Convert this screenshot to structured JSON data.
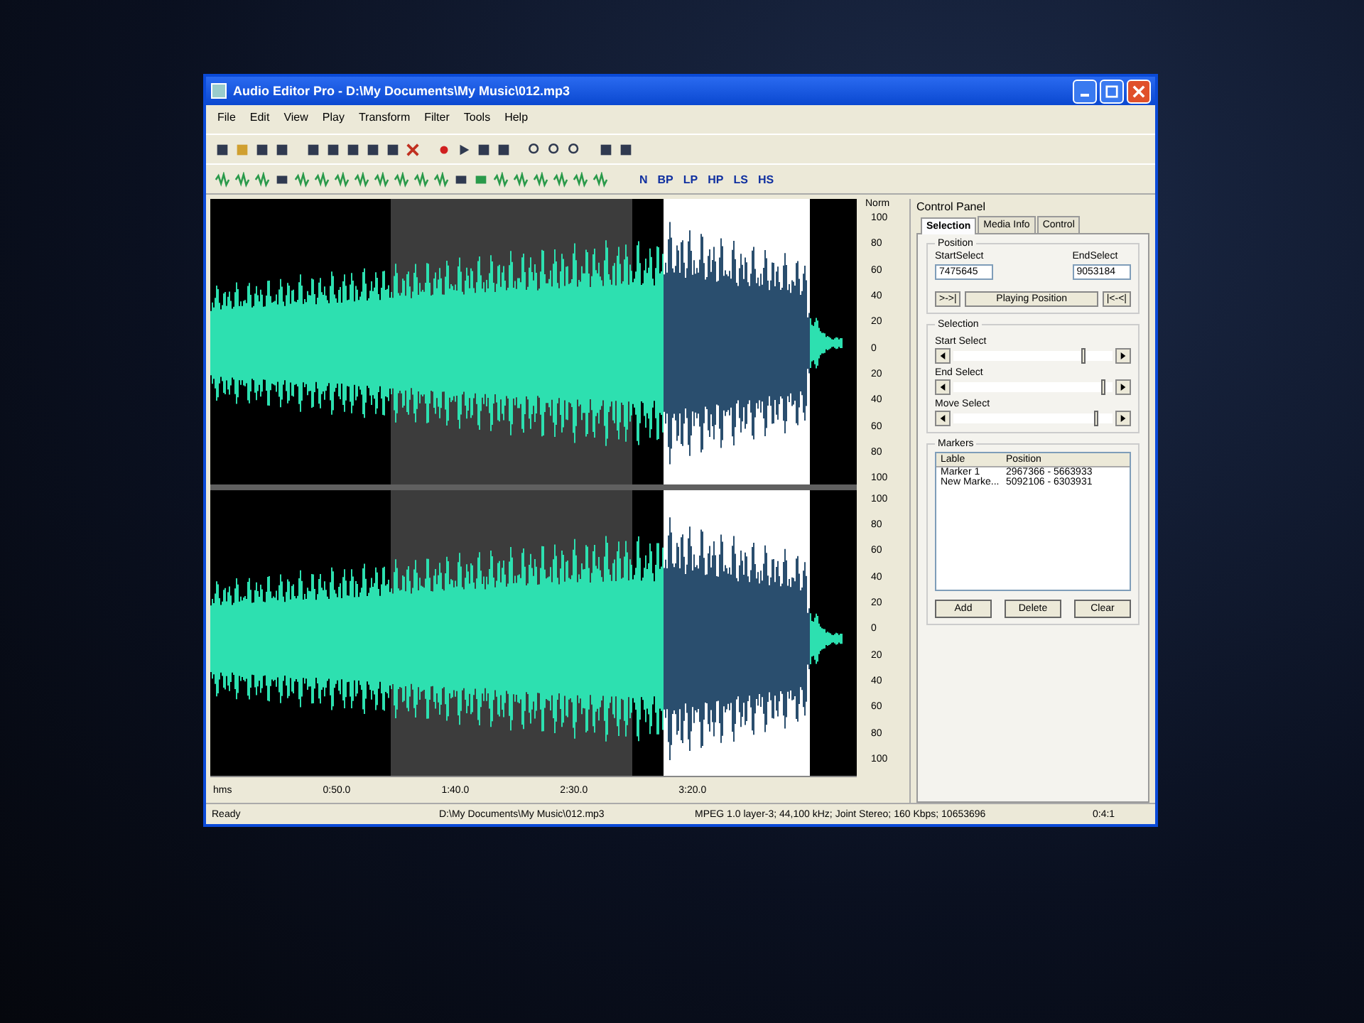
{
  "window": {
    "title": "Audio Editor Pro - D:\\My Documents\\My Music\\012.mp3"
  },
  "menu": [
    "File",
    "Edit",
    "View",
    "Play",
    "Transform",
    "Filter",
    "Tools",
    "Help"
  ],
  "filter_buttons": [
    "N",
    "BP",
    "LP",
    "HP",
    "LS",
    "HS"
  ],
  "scale": {
    "header": "Norm",
    "channel_1": [
      "100",
      "80",
      "60",
      "40",
      "20",
      "0",
      "20",
      "40",
      "60",
      "80",
      "100"
    ],
    "channel_2": [
      "100",
      "80",
      "60",
      "40",
      "20",
      "0",
      "20",
      "40",
      "60",
      "80",
      "100"
    ]
  },
  "time_ruler": {
    "unit": "hms",
    "ticks": [
      "0:50.0",
      "1:40.0",
      "2:30.0",
      "3:20.0"
    ]
  },
  "control_panel": {
    "title": "Control Panel",
    "tabs": [
      {
        "label": "Selection",
        "selected": true
      },
      {
        "label": "Media Info",
        "selected": false
      },
      {
        "label": "Control",
        "selected": false
      }
    ],
    "position": {
      "title": "Position",
      "start_label": "StartSelect",
      "start_value": "7475645",
      "end_label": "EndSelect",
      "end_value": "9053184",
      "buttons": [
        ">->|",
        "Playing Position",
        "|<-<|"
      ]
    },
    "selection": {
      "title": "Selection",
      "sliders": [
        {
          "label": "Start Select",
          "level": 0.82
        },
        {
          "label": "End Select",
          "level": 0.95
        },
        {
          "label": "Move Select",
          "level": 0.9
        }
      ]
    },
    "markers": {
      "title": "Markers",
      "columns": [
        "Lable",
        "Position"
      ],
      "rows": [
        {
          "label": "Marker 1",
          "position": "2967366 - 5663933"
        },
        {
          "label": "New Marke...",
          "position": "5092106 - 6303931"
        }
      ],
      "buttons": [
        "Add",
        "Delete",
        "Clear"
      ]
    }
  },
  "status_bar": [
    "Ready",
    "D:\\My Documents\\My Music\\012.mp3",
    "MPEG 1.0 layer-3; 44,100 kHz; Joint Stereo; 160 Kbps; 10653696",
    "0:4:1"
  ]
}
